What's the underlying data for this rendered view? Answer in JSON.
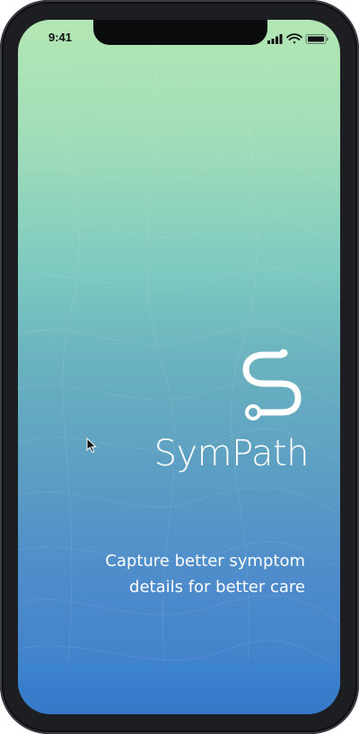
{
  "status_bar": {
    "time": "9:41"
  },
  "app": {
    "name": "SymPath",
    "tagline_line1": "Capture better symptom",
    "tagline_line2": "details for better care"
  },
  "icons": {
    "logo": "sympath-logo-icon",
    "signal": "signal-icon",
    "wifi": "wifi-icon",
    "battery": "battery-icon",
    "cursor": "mouse-pointer-icon"
  },
  "colors": {
    "gradient_top": "#b3e6b4",
    "gradient_bottom": "#3b7dcb",
    "text": "#ffffff"
  }
}
